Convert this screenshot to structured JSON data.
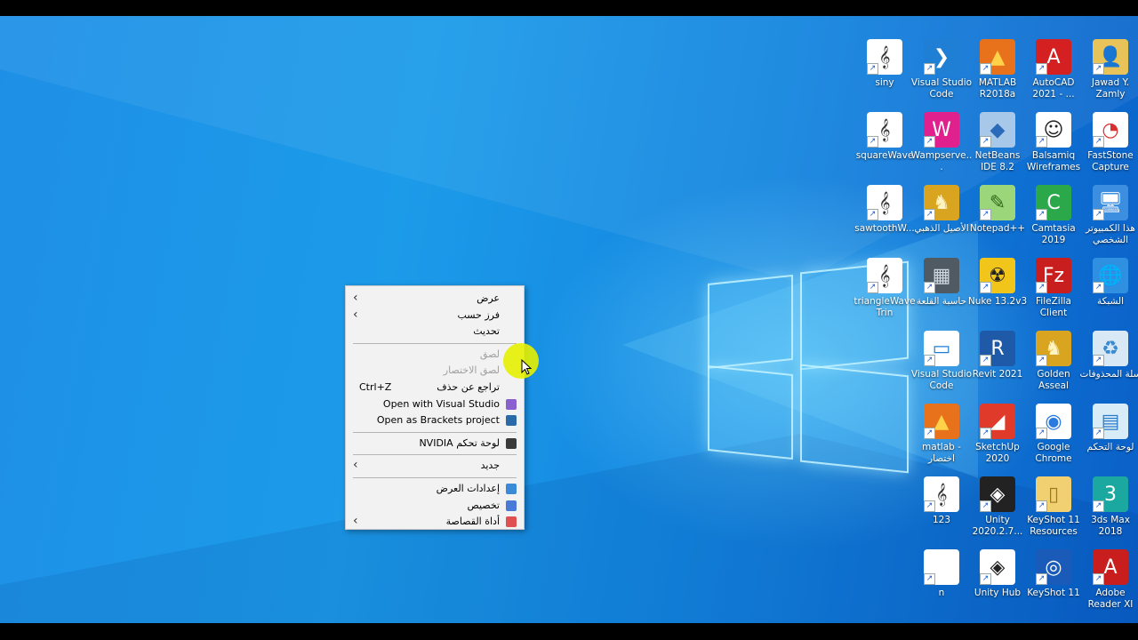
{
  "desktop": {
    "icons": [
      {
        "name": "siny",
        "label": "siny",
        "icon": "music-note-icon",
        "bg": "#ffffff",
        "glyph": "𝄞",
        "fg": "#333333"
      },
      {
        "name": "vscode-1",
        "label": "Visual Studio Code",
        "icon": "vscode-icon",
        "bg": "#1f7fd4",
        "glyph": "❯",
        "fg": "#ffffff"
      },
      {
        "name": "matlab-r2018a",
        "label": "MATLAB R2018a",
        "icon": "matlab-icon",
        "bg": "#e8721c",
        "glyph": "▲",
        "fg": "#ffd24a"
      },
      {
        "name": "autocad",
        "label": "AutoCAD 2021 - ...",
        "icon": "autocad-icon",
        "bg": "#d42020",
        "glyph": "A",
        "fg": "#ffffff"
      },
      {
        "name": "jawad",
        "label": "Jawad Y. Zamly",
        "icon": "user-folder-icon",
        "bg": "#e8c35a",
        "glyph": "👤",
        "fg": "#8a5a10"
      },
      {
        "name": "squarewave",
        "label": "squareWave",
        "icon": "music-note-icon",
        "bg": "#ffffff",
        "glyph": "𝄞",
        "fg": "#333333"
      },
      {
        "name": "wampserver",
        "label": "Wampserve...",
        "icon": "wampserver-icon",
        "bg": "#e0208c",
        "glyph": "W",
        "fg": "#ffffff"
      },
      {
        "name": "netbeans",
        "label": "NetBeans IDE 8.2",
        "icon": "netbeans-icon",
        "bg": "#a8c8ea",
        "glyph": "◆",
        "fg": "#2a6ab8"
      },
      {
        "name": "balsamiq",
        "label": "Balsamiq Wireframes",
        "icon": "balsamiq-icon",
        "bg": "#ffffff",
        "glyph": "☺",
        "fg": "#222222"
      },
      {
        "name": "faststone",
        "label": "FastStone Capture",
        "icon": "faststone-icon",
        "bg": "#ffffff",
        "glyph": "◔",
        "fg": "#d83030"
      },
      {
        "name": "sawtooth",
        "label": "sawtoothW...",
        "icon": "music-note-icon",
        "bg": "#ffffff",
        "glyph": "𝄞",
        "fg": "#333333"
      },
      {
        "name": "golden-horse",
        "label": "الأصيل الذهبي",
        "icon": "horse-icon",
        "bg": "#d9a520",
        "glyph": "♞",
        "fg": "#fff3c0"
      },
      {
        "name": "notepadpp",
        "label": "Notepad++",
        "icon": "notepadpp-icon",
        "bg": "#9cd67a",
        "glyph": "✎",
        "fg": "#2d6a1a"
      },
      {
        "name": "camtasia",
        "label": "Camtasia 2019",
        "icon": "camtasia-icon",
        "bg": "#2aa84a",
        "glyph": "C",
        "fg": "#ffffff"
      },
      {
        "name": "this-pc",
        "label": "هذا الكمبيوتر الشخصي",
        "icon": "computer-icon",
        "bg": "#3c8ee0",
        "glyph": "🖥",
        "fg": "#ffffff"
      },
      {
        "name": "triangle",
        "label": "triangleWave Trin",
        "icon": "music-note-icon",
        "bg": "#ffffff",
        "glyph": "𝄞",
        "fg": "#333333"
      },
      {
        "name": "calculator",
        "label": "حاسبة القلعة",
        "icon": "calculator-icon",
        "bg": "#505a62",
        "glyph": "▦",
        "fg": "#d0d8e0"
      },
      {
        "name": "nuke",
        "label": "Nuke 13.2v3",
        "icon": "nuke-icon",
        "bg": "#f2c51a",
        "glyph": "☢",
        "fg": "#222222"
      },
      {
        "name": "filezilla",
        "label": "FileZilla Client",
        "icon": "filezilla-icon",
        "bg": "#c81e1e",
        "glyph": "Fz",
        "fg": "#ffffff"
      },
      {
        "name": "network",
        "label": "الشبكة",
        "icon": "network-icon",
        "bg": "#2f8fe0",
        "glyph": "🌐",
        "fg": "#ffffff"
      },
      {
        "name": "vscode-2",
        "label": "Visual Studio Code",
        "icon": "vscode-icon",
        "bg": "#ffffff",
        "glyph": "▭",
        "fg": "#1f7fd4"
      },
      {
        "name": "revit",
        "label": "Revit 2021",
        "icon": "revit-icon",
        "bg": "#1f5aa8",
        "glyph": "R",
        "fg": "#ffffff"
      },
      {
        "name": "golden-asseal",
        "label": "Golden Asseal",
        "icon": "horse-icon",
        "bg": "#d9a520",
        "glyph": "♞",
        "fg": "#fff3c0"
      },
      {
        "name": "recycle-bin",
        "label": "سلة المحذوفات",
        "icon": "recycle-bin-icon",
        "bg": "#d8e8f4",
        "glyph": "♻",
        "fg": "#3a8ad0"
      },
      {
        "name": "matlab-shortcut",
        "label": "matlab - اختصار",
        "icon": "matlab-icon",
        "bg": "#e8721c",
        "glyph": "▲",
        "fg": "#ffd24a"
      },
      {
        "name": "sketchup",
        "label": "SketchUp 2020",
        "icon": "sketchup-icon",
        "bg": "#e03a2a",
        "glyph": "◢",
        "fg": "#ffffff"
      },
      {
        "name": "chrome",
        "label": "Google Chrome",
        "icon": "chrome-icon",
        "bg": "#ffffff",
        "glyph": "◉",
        "fg": "#2a7ae0"
      },
      {
        "name": "control-panel",
        "label": "لوحة التحكم",
        "icon": "control-panel-icon",
        "bg": "#d8ecf8",
        "glyph": "▤",
        "fg": "#2a7ac8"
      },
      {
        "name": "file-123",
        "label": "123",
        "icon": "music-note-icon",
        "bg": "#ffffff",
        "glyph": "𝄞",
        "fg": "#333333"
      },
      {
        "name": "unity-2020",
        "label": "Unity 2020.2.7...",
        "icon": "unity-icon",
        "bg": "#222222",
        "glyph": "◈",
        "fg": "#ffffff"
      },
      {
        "name": "keyshot-res",
        "label": "KeyShot 11 Resources",
        "icon": "folder-icon",
        "bg": "#f0d070",
        "glyph": "▯",
        "fg": "#a07820"
      },
      {
        "name": "3dsmax",
        "label": "3ds Max 2018",
        "icon": "3dsmax-icon",
        "bg": "#1aa8a0",
        "glyph": "3",
        "fg": "#ffffff"
      },
      {
        "name": "file-n",
        "label": "n",
        "icon": "file-icon",
        "bg": "#ffffff",
        "glyph": "",
        "fg": "#333333"
      },
      {
        "name": "unity-hub",
        "label": "Unity Hub",
        "icon": "unity-icon",
        "bg": "#ffffff",
        "glyph": "◈",
        "fg": "#222222"
      },
      {
        "name": "keyshot11",
        "label": "KeyShot 11",
        "icon": "keyshot-icon",
        "bg": "#1a5ab8",
        "glyph": "◎",
        "fg": "#ffffff"
      },
      {
        "name": "adobe-reader",
        "label": "Adobe Reader XI",
        "icon": "adobe-reader-icon",
        "bg": "#c81e1e",
        "glyph": "A",
        "fg": "#ffffff"
      }
    ]
  },
  "context_menu": {
    "items": [
      {
        "name": "menu-item-view",
        "label": "عرض",
        "arrow": "‹",
        "type": "item"
      },
      {
        "name": "menu-item-sort-by",
        "label": "فرز حسب",
        "arrow": "‹",
        "type": "item"
      },
      {
        "name": "menu-item-refresh",
        "label": "تحديث",
        "type": "item"
      },
      {
        "type": "sep"
      },
      {
        "name": "menu-item-paste",
        "label": "لصق",
        "type": "item",
        "disabled": true
      },
      {
        "name": "menu-item-paste-shortcut",
        "label": "لصق الاختصار",
        "type": "item",
        "disabled": true
      },
      {
        "name": "menu-item-undo-delete",
        "label": "تراجع عن حذف",
        "shortcut": "Ctrl+Z",
        "type": "item"
      },
      {
        "name": "menu-item-open-visual-studio",
        "label": "Open with Visual Studio",
        "icon": "visual-studio-icon",
        "iconColor": "#8a5fd0",
        "type": "item"
      },
      {
        "name": "menu-item-open-brackets",
        "label": "Open as Brackets project",
        "icon": "brackets-icon",
        "iconColor": "#2a6aa8",
        "type": "item"
      },
      {
        "type": "sep"
      },
      {
        "name": "menu-item-nvidia",
        "label": "لوحة تحكم NVIDIA",
        "icon": "nvidia-icon",
        "iconColor": "#3a3a3a",
        "type": "item"
      },
      {
        "type": "sep"
      },
      {
        "name": "menu-item-new",
        "label": "جديد",
        "arrow": "‹",
        "type": "item"
      },
      {
        "type": "sep"
      },
      {
        "name": "menu-item-display-settings",
        "label": "إعدادات العرض",
        "icon": "display-settings-icon",
        "iconColor": "#3a8ad8",
        "type": "item"
      },
      {
        "name": "menu-item-personalize",
        "label": "تخصيص",
        "icon": "personalize-icon",
        "iconColor": "#4a7ad8",
        "type": "item"
      },
      {
        "name": "menu-item-snipping-tool",
        "label": "أداة القصاصة",
        "arrow": "‹",
        "icon": "snipping-tool-icon",
        "iconColor": "#e05050",
        "type": "item"
      }
    ]
  }
}
